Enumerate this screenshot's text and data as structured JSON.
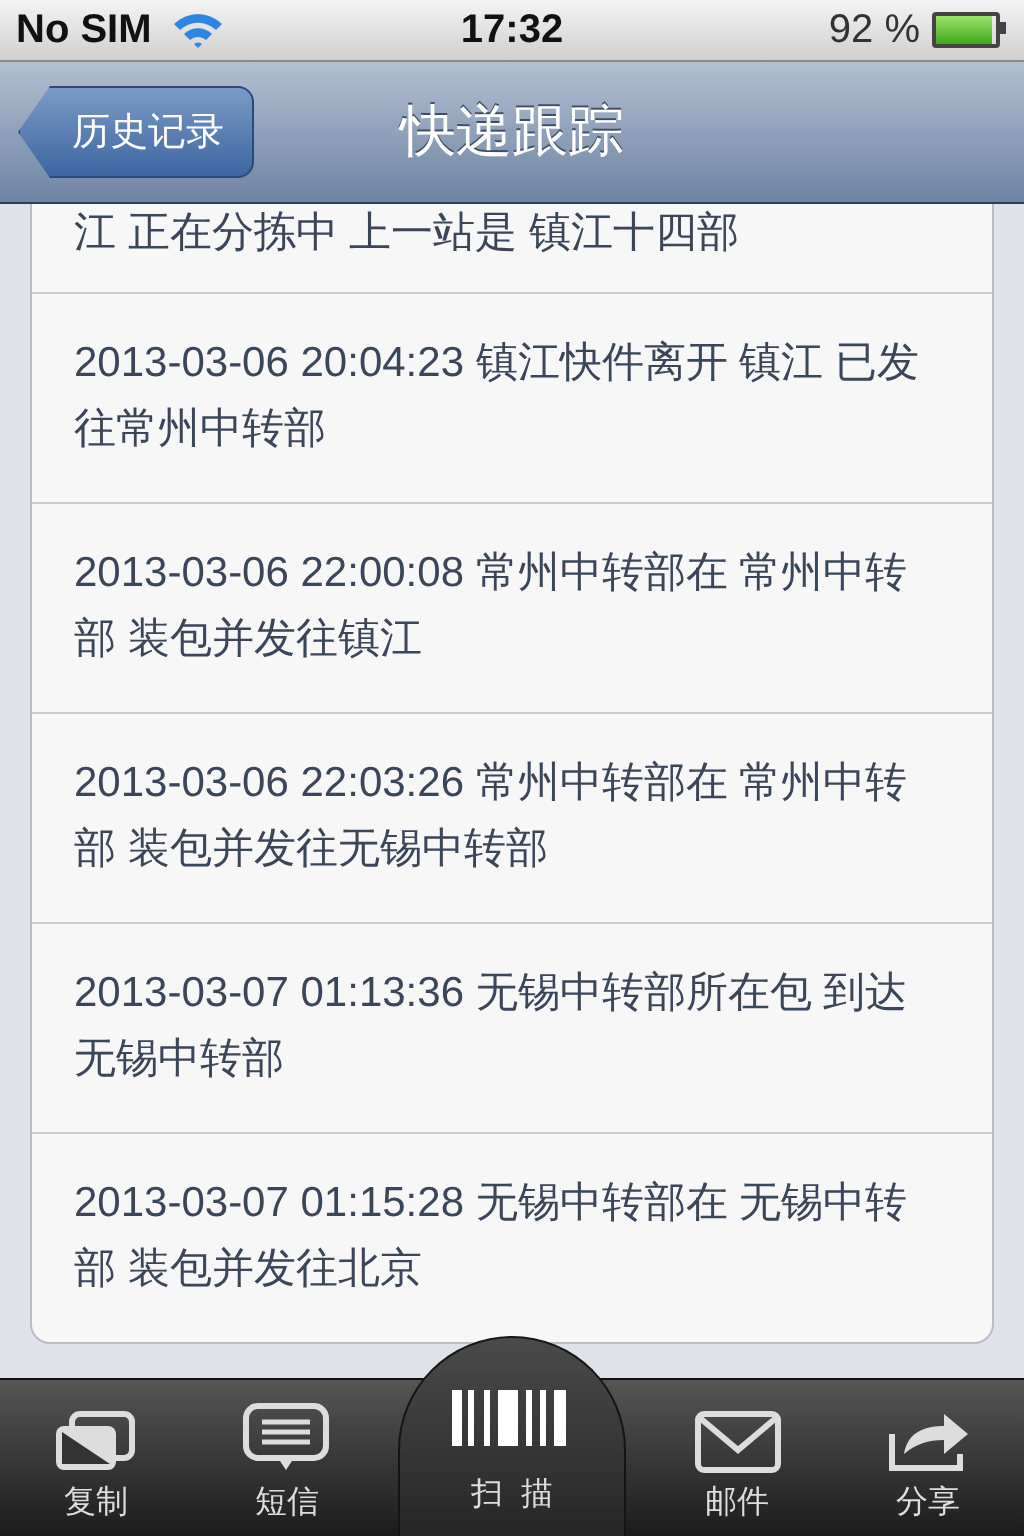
{
  "status_bar": {
    "carrier": "No SIM",
    "time": "17:32",
    "battery": "92 %"
  },
  "nav": {
    "back": "历史记录",
    "title": "快递跟踪"
  },
  "records": [
    {
      "text": "江 正在分拣中 上一站是 镇江十四部"
    },
    {
      "text": "2013-03-06 20:04:23 镇江快件离开 镇江 已发往常州中转部"
    },
    {
      "text": "2013-03-06 22:00:08 常州中转部在 常州中转部 装包并发往镇江"
    },
    {
      "text": "2013-03-06 22:03:26 常州中转部在 常州中转部 装包并发往无锡中转部"
    },
    {
      "text": "2013-03-07 01:13:36 无锡中转部所在包 到达无锡中转部"
    },
    {
      "text": "2013-03-07 01:15:28 无锡中转部在 无锡中转部 装包并发往北京"
    }
  ],
  "toolbar": [
    {
      "kind": "copy",
      "label": "复制"
    },
    {
      "kind": "sms",
      "label": "短信"
    },
    {
      "kind": "scan",
      "label": "扫  描"
    },
    {
      "kind": "mail",
      "label": "邮件"
    },
    {
      "kind": "share",
      "label": "分享"
    }
  ]
}
